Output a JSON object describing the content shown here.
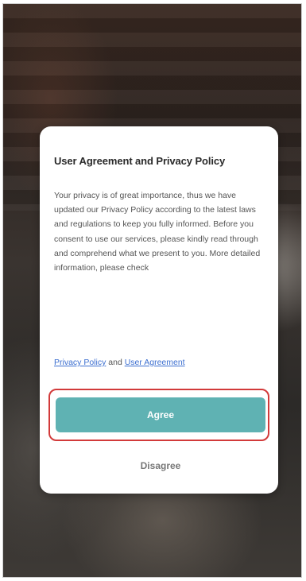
{
  "dialog": {
    "title": "User Agreement and Privacy Policy",
    "body": "Your privacy is of great importance, thus we have updated our Privacy Policy according to the latest laws and regulations to keep you fully informed. Before you consent to use our services, please kindly read through and comprehend what we present to you.  More detailed information, please check",
    "privacy_link": "Privacy Policy",
    "and_text": " and ",
    "agreement_link": "User Agreement",
    "agree_label": "Agree",
    "disagree_label": "Disagree"
  },
  "colors": {
    "agree_button": "#5fb2b3",
    "highlight_border": "#d23a3a",
    "link": "#3c6fd0"
  }
}
